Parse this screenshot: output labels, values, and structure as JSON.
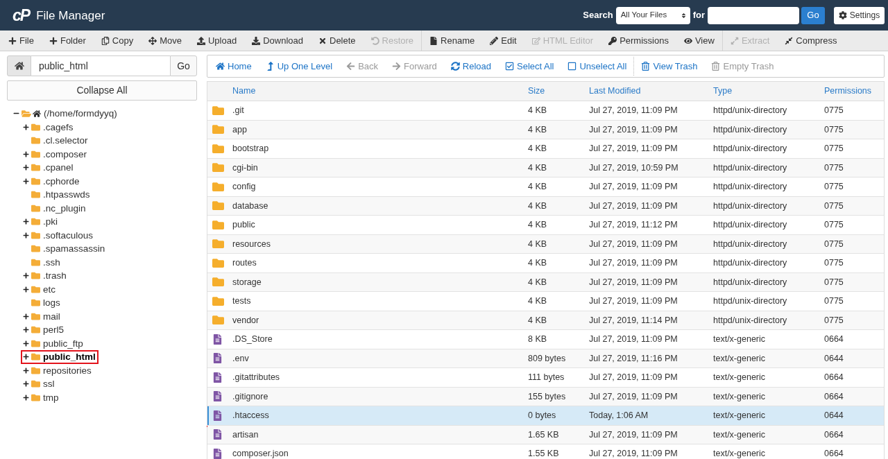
{
  "header": {
    "logo": "cP",
    "title": "File Manager",
    "search": {
      "label": "Search",
      "scope": "All Your Files",
      "for_label": "for",
      "button": "Go"
    },
    "settings_button": "Settings"
  },
  "toolbar": [
    {
      "items": [
        {
          "label": "File",
          "disabled": false
        },
        {
          "label": "Folder",
          "disabled": false
        },
        {
          "label": "Copy",
          "disabled": false
        },
        {
          "label": "Move",
          "disabled": false
        },
        {
          "label": "Upload",
          "disabled": false
        },
        {
          "label": "Download",
          "disabled": false
        },
        {
          "label": "Delete",
          "disabled": false
        },
        {
          "label": "Restore",
          "disabled": true
        }
      ]
    },
    {
      "items": [
        {
          "label": "Rename",
          "disabled": false
        },
        {
          "label": "Edit",
          "disabled": false
        },
        {
          "label": "HTML Editor",
          "disabled": true
        },
        {
          "label": "Permissions",
          "disabled": false
        },
        {
          "label": "View",
          "disabled": false
        }
      ]
    },
    {
      "items": [
        {
          "label": "Extract",
          "disabled": true
        },
        {
          "label": "Compress",
          "disabled": false
        }
      ]
    }
  ],
  "sidebar": {
    "path": {
      "value": "public_html",
      "button": "Go"
    },
    "collapse_button": "Collapse All",
    "tree": {
      "label": "(/home/formdyyq)",
      "expanded": true,
      "children": [
        {
          "label": ".cagefs",
          "expanded": false,
          "selected": false,
          "annotated": false
        },
        {
          "label": ".cl.selector",
          "selected": false,
          "annotated": false
        },
        {
          "label": ".composer",
          "expanded": false,
          "selected": false,
          "annotated": false
        },
        {
          "label": ".cpanel",
          "expanded": false,
          "selected": false,
          "annotated": false
        },
        {
          "label": ".cphorde",
          "expanded": false,
          "selected": false,
          "annotated": false
        },
        {
          "label": ".htpasswds",
          "selected": false,
          "annotated": false
        },
        {
          "label": ".nc_plugin",
          "selected": false,
          "annotated": false
        },
        {
          "label": ".pki",
          "expanded": false,
          "selected": false,
          "annotated": false
        },
        {
          "label": ".softaculous",
          "expanded": false,
          "selected": false,
          "annotated": false
        },
        {
          "label": ".spamassassin",
          "selected": false,
          "annotated": false
        },
        {
          "label": ".ssh",
          "selected": false,
          "annotated": false
        },
        {
          "label": ".trash",
          "expanded": false,
          "selected": false,
          "annotated": false
        },
        {
          "label": "etc",
          "expanded": false,
          "selected": false,
          "annotated": false
        },
        {
          "label": "logs",
          "selected": false,
          "annotated": false
        },
        {
          "label": "mail",
          "expanded": false,
          "selected": false,
          "annotated": false
        },
        {
          "label": "perl5",
          "expanded": false,
          "selected": false,
          "annotated": false
        },
        {
          "label": "public_ftp",
          "expanded": false,
          "selected": false,
          "annotated": false
        },
        {
          "label": "public_html",
          "expanded": false,
          "selected": true,
          "annotated": true
        },
        {
          "label": "repositories",
          "expanded": false,
          "selected": false,
          "annotated": false
        },
        {
          "label": "ssl",
          "expanded": false,
          "selected": false,
          "annotated": false
        },
        {
          "label": "tmp",
          "expanded": false,
          "selected": false,
          "annotated": false
        }
      ]
    }
  },
  "navbar": [
    {
      "items": [
        {
          "label": "Home",
          "disabled": false
        },
        {
          "label": "Up One Level",
          "disabled": false
        },
        {
          "label": "Back",
          "disabled": true
        },
        {
          "label": "Forward",
          "disabled": true
        },
        {
          "label": "Reload",
          "disabled": false
        },
        {
          "label": "Select All",
          "disabled": false
        },
        {
          "label": "Unselect All",
          "disabled": false
        }
      ]
    },
    {
      "items": [
        {
          "label": "View Trash",
          "disabled": false
        },
        {
          "label": "Empty Trash",
          "disabled": true
        }
      ]
    }
  ],
  "table": {
    "columns": [
      "Name",
      "Size",
      "Last Modified",
      "Type",
      "Permissions"
    ],
    "rows": [
      {
        "kind": "folder",
        "name": ".git",
        "size": "4 KB",
        "modified": "Jul 27, 2019, 11:09 PM",
        "type": "httpd/unix-directory",
        "permissions": "0775",
        "selected": false,
        "annotated": false
      },
      {
        "kind": "folder",
        "name": "app",
        "size": "4 KB",
        "modified": "Jul 27, 2019, 11:09 PM",
        "type": "httpd/unix-directory",
        "permissions": "0775",
        "selected": false,
        "annotated": false
      },
      {
        "kind": "folder",
        "name": "bootstrap",
        "size": "4 KB",
        "modified": "Jul 27, 2019, 11:09 PM",
        "type": "httpd/unix-directory",
        "permissions": "0775",
        "selected": false,
        "annotated": false
      },
      {
        "kind": "folder",
        "name": "cgi-bin",
        "size": "4 KB",
        "modified": "Jul 27, 2019, 10:59 PM",
        "type": "httpd/unix-directory",
        "permissions": "0775",
        "selected": false,
        "annotated": false
      },
      {
        "kind": "folder",
        "name": "config",
        "size": "4 KB",
        "modified": "Jul 27, 2019, 11:09 PM",
        "type": "httpd/unix-directory",
        "permissions": "0775",
        "selected": false,
        "annotated": false
      },
      {
        "kind": "folder",
        "name": "database",
        "size": "4 KB",
        "modified": "Jul 27, 2019, 11:09 PM",
        "type": "httpd/unix-directory",
        "permissions": "0775",
        "selected": false,
        "annotated": false
      },
      {
        "kind": "folder",
        "name": "public",
        "size": "4 KB",
        "modified": "Jul 27, 2019, 11:12 PM",
        "type": "httpd/unix-directory",
        "permissions": "0775",
        "selected": false,
        "annotated": false
      },
      {
        "kind": "folder",
        "name": "resources",
        "size": "4 KB",
        "modified": "Jul 27, 2019, 11:09 PM",
        "type": "httpd/unix-directory",
        "permissions": "0775",
        "selected": false,
        "annotated": false
      },
      {
        "kind": "folder",
        "name": "routes",
        "size": "4 KB",
        "modified": "Jul 27, 2019, 11:09 PM",
        "type": "httpd/unix-directory",
        "permissions": "0775",
        "selected": false,
        "annotated": false
      },
      {
        "kind": "folder",
        "name": "storage",
        "size": "4 KB",
        "modified": "Jul 27, 2019, 11:09 PM",
        "type": "httpd/unix-directory",
        "permissions": "0775",
        "selected": false,
        "annotated": false
      },
      {
        "kind": "folder",
        "name": "tests",
        "size": "4 KB",
        "modified": "Jul 27, 2019, 11:09 PM",
        "type": "httpd/unix-directory",
        "permissions": "0775",
        "selected": false,
        "annotated": false
      },
      {
        "kind": "folder",
        "name": "vendor",
        "size": "4 KB",
        "modified": "Jul 27, 2019, 11:14 PM",
        "type": "httpd/unix-directory",
        "permissions": "0775",
        "selected": false,
        "annotated": false
      },
      {
        "kind": "file",
        "name": ".DS_Store",
        "size": "8 KB",
        "modified": "Jul 27, 2019, 11:09 PM",
        "type": "text/x-generic",
        "permissions": "0664",
        "selected": false,
        "annotated": false
      },
      {
        "kind": "file",
        "name": ".env",
        "size": "809 bytes",
        "modified": "Jul 27, 2019, 11:16 PM",
        "type": "text/x-generic",
        "permissions": "0644",
        "selected": false,
        "annotated": false
      },
      {
        "kind": "file",
        "name": ".gitattributes",
        "size": "111 bytes",
        "modified": "Jul 27, 2019, 11:09 PM",
        "type": "text/x-generic",
        "permissions": "0664",
        "selected": false,
        "annotated": false
      },
      {
        "kind": "file",
        "name": ".gitignore",
        "size": "155 bytes",
        "modified": "Jul 27, 2019, 11:09 PM",
        "type": "text/x-generic",
        "permissions": "0664",
        "selected": false,
        "annotated": false
      },
      {
        "kind": "file",
        "name": ".htaccess",
        "size": "0 bytes",
        "modified": "Today, 1:06 AM",
        "type": "text/x-generic",
        "permissions": "0644",
        "selected": true,
        "annotated": true
      },
      {
        "kind": "file",
        "name": "artisan",
        "size": "1.65 KB",
        "modified": "Jul 27, 2019, 11:09 PM",
        "type": "text/x-generic",
        "permissions": "0664",
        "selected": false,
        "annotated": false
      },
      {
        "kind": "file",
        "name": "composer.json",
        "size": "1.55 KB",
        "modified": "Jul 27, 2019, 11:09 PM",
        "type": "text/x-generic",
        "permissions": "0664",
        "selected": false,
        "annotated": false
      }
    ]
  }
}
